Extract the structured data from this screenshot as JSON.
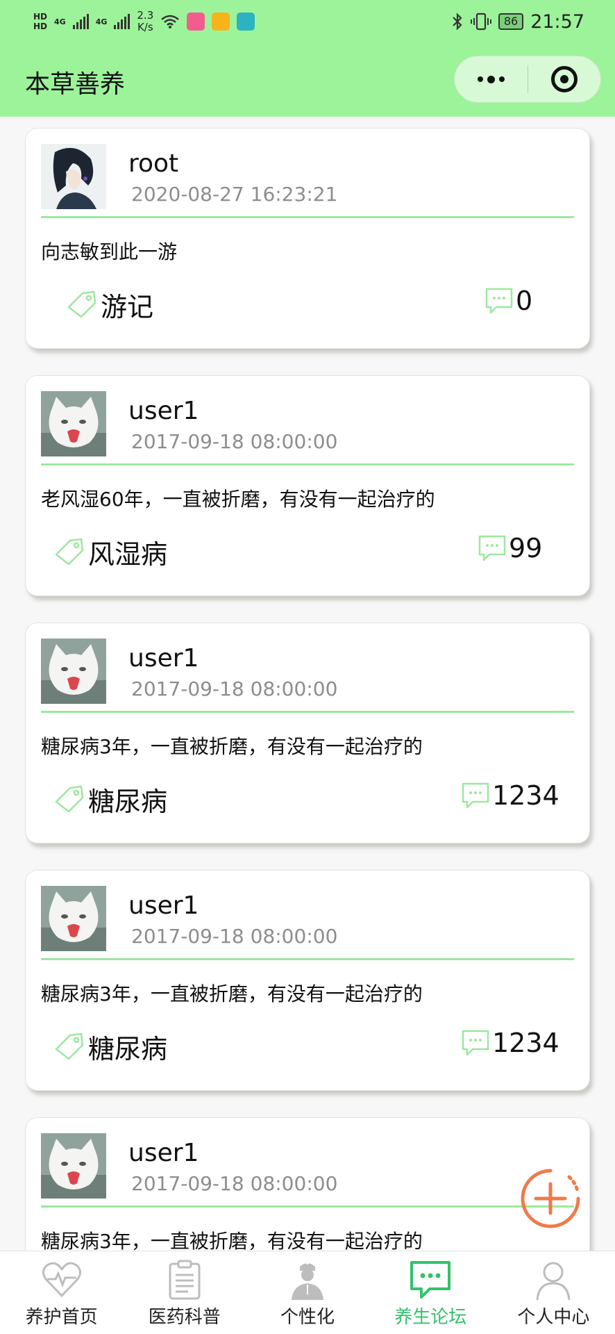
{
  "status_bar": {
    "hd1": "HD",
    "hd2": "HD",
    "net1": "4G",
    "net2": "4G",
    "speed_value": "2.3",
    "speed_unit": "K/s",
    "battery": "86",
    "time": "21:57",
    "icons": [
      "wifi-icon",
      "bilibili-app-icon",
      "mail-app-icon",
      "boss-app-icon",
      "bluetooth-icon",
      "vibrate-icon"
    ]
  },
  "header": {
    "title": "本草善养",
    "capsule_icons": [
      "more-icon",
      "close-target-icon"
    ]
  },
  "posts": [
    {
      "username": "root",
      "timestamp": "2020-08-27 16:23:21",
      "content": "向志敏到此一游",
      "tag": "游记",
      "comment_count": "0",
      "avatar": "anime-avatar"
    },
    {
      "username": "user1",
      "timestamp": "2017-09-18 08:00:00",
      "content": "老风湿60年，一直被折磨，有没有一起治疗的",
      "tag": "风湿病",
      "comment_count": "99",
      "avatar": "cat-avatar"
    },
    {
      "username": "user1",
      "timestamp": "2017-09-18 08:00:00",
      "content": "糖尿病3年，一直被折磨，有没有一起治疗的",
      "tag": "糖尿病",
      "comment_count": "1234",
      "avatar": "cat-avatar"
    },
    {
      "username": "user1",
      "timestamp": "2017-09-18 08:00:00",
      "content": "糖尿病3年，一直被折磨，有没有一起治疗的",
      "tag": "糖尿病",
      "comment_count": "1234",
      "avatar": "cat-avatar"
    },
    {
      "username": "user1",
      "timestamp": "2017-09-18 08:00:00",
      "content": "糖尿病3年，一直被折磨，有没有一起治疗的",
      "tag": "",
      "comment_count": "",
      "avatar": "cat-avatar"
    }
  ],
  "fab": {
    "icon": "add-icon",
    "color": "#f07a4a"
  },
  "tabs": [
    {
      "label": "养护首页",
      "icon": "heart-pulse-icon",
      "active": false
    },
    {
      "label": "医药科普",
      "icon": "clipboard-icon",
      "active": false
    },
    {
      "label": "个性化",
      "icon": "doctor-icon",
      "active": false
    },
    {
      "label": "养生论坛",
      "icon": "chat-bubble-icon",
      "active": true
    },
    {
      "label": "个人中心",
      "icon": "person-icon",
      "active": false
    }
  ],
  "colors": {
    "brand_green": "#9df39a",
    "active_tab": "#33c26a",
    "divider": "#9de89e",
    "accent_orange": "#f07a4a"
  }
}
